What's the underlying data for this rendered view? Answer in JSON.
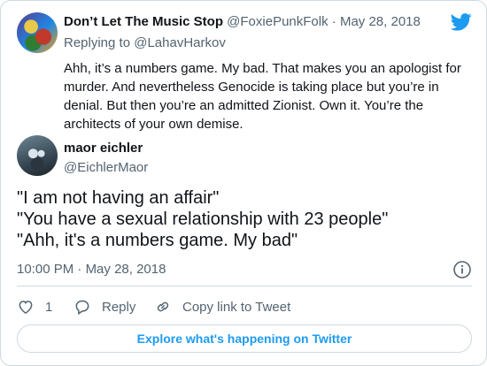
{
  "quoted": {
    "display_name": "Don’t Let The Music Stop",
    "handle": "@FoxiePunkFolk",
    "separator": "·",
    "date": "May 28, 2018",
    "reply_prefix": "Replying to ",
    "reply_handle": "@LahavHarkov",
    "body": "Ahh, it’s a numbers game. My bad. That makes you an apologist for murder. And nevertheless Genocide is taking place but you’re in denial. But then you’re an admitted Zionist. Own it. You’re the architects of your own demise."
  },
  "tweet": {
    "display_name": "maor eichler",
    "handle": "@EichlerMaor",
    "lines": [
      "\"I am not having an affair\"",
      "\"You have a sexual relationship with 23 people\"",
      "\"Ahh, it's a numbers game. My bad\""
    ],
    "time": "10:00 PM",
    "separator": "·",
    "date": "May 28, 2018"
  },
  "actions": {
    "like_count": "1",
    "reply_label": "Reply",
    "copy_label": "Copy link to Tweet"
  },
  "explore_label": "Explore what's happening on Twitter",
  "icons": {
    "brand": "twitter-bird-icon",
    "info": "info-icon",
    "like": "heart-icon",
    "reply": "reply-bubble-icon",
    "copy": "link-icon"
  },
  "colors": {
    "accent": "#1d9bf0",
    "muted_text": "#536471",
    "text": "#0f1419",
    "border": "#cfd9de"
  }
}
